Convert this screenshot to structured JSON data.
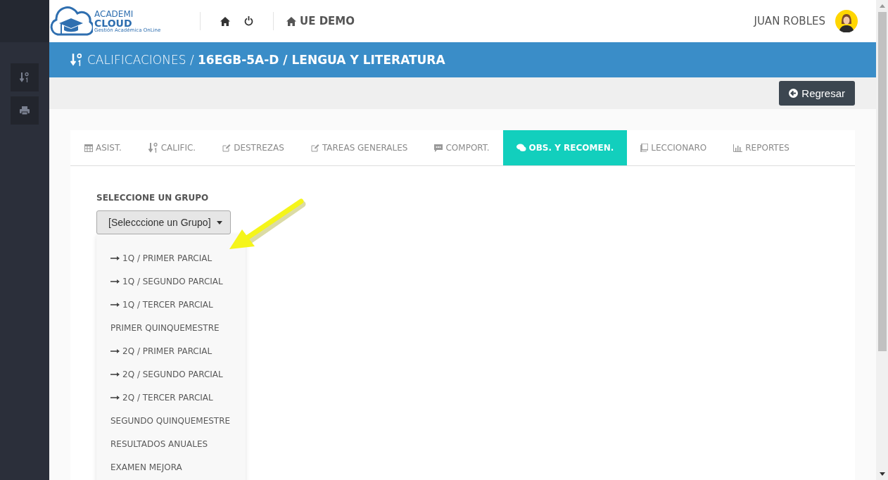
{
  "logo": {
    "line1": "ACADEMI",
    "line2": "CLOUD",
    "tagline": "Gestión Académica OnLine"
  },
  "header": {
    "school": "UE DEMO",
    "user": "JUAN ROBLES"
  },
  "breadcrumb": "CALIFICACIONES / **16EGB-5A-D / LENGUA Y LITERATURA**",
  "back_button": "Regresar",
  "tabs": [
    {
      "label": "ASIST.",
      "selected": false
    },
    {
      "label": "CALIFIC.",
      "selected": false
    },
    {
      "label": "DESTREZAS",
      "selected": false
    },
    {
      "label": "TAREAS GENERALES",
      "selected": false
    },
    {
      "label": "COMPORT.",
      "selected": false
    },
    {
      "label": "OBS. Y RECOMEN.",
      "selected": true
    },
    {
      "label": "LECCIONARO",
      "selected": false
    },
    {
      "label": "REPORTES",
      "selected": false
    }
  ],
  "group_label": "SELECCIONE UN GRUPO",
  "group_select": {
    "value": "[Selecccione un Grupo]",
    "expanded": true
  },
  "group_options": [
    {
      "label": "1Q / PRIMER PARCIAL",
      "kind": "partial"
    },
    {
      "label": "1Q / SEGUNDO PARCIAL",
      "kind": "partial"
    },
    {
      "label": "1Q / TERCER PARCIAL",
      "kind": "partial"
    },
    {
      "label": "PRIMER QUINQUEMESTRE",
      "kind": "period"
    },
    {
      "label": "2Q / PRIMER PARCIAL",
      "kind": "partial"
    },
    {
      "label": "2Q / SEGUNDO PARCIAL",
      "kind": "partial"
    },
    {
      "label": "2Q / TERCER PARCIAL",
      "kind": "partial"
    },
    {
      "label": "SEGUNDO QUINQUEMESTRE",
      "kind": "period"
    },
    {
      "label": "RESULTADOS ANUALES",
      "kind": "period"
    },
    {
      "label": "EXAMEN MEJORA",
      "kind": "period"
    }
  ]
}
